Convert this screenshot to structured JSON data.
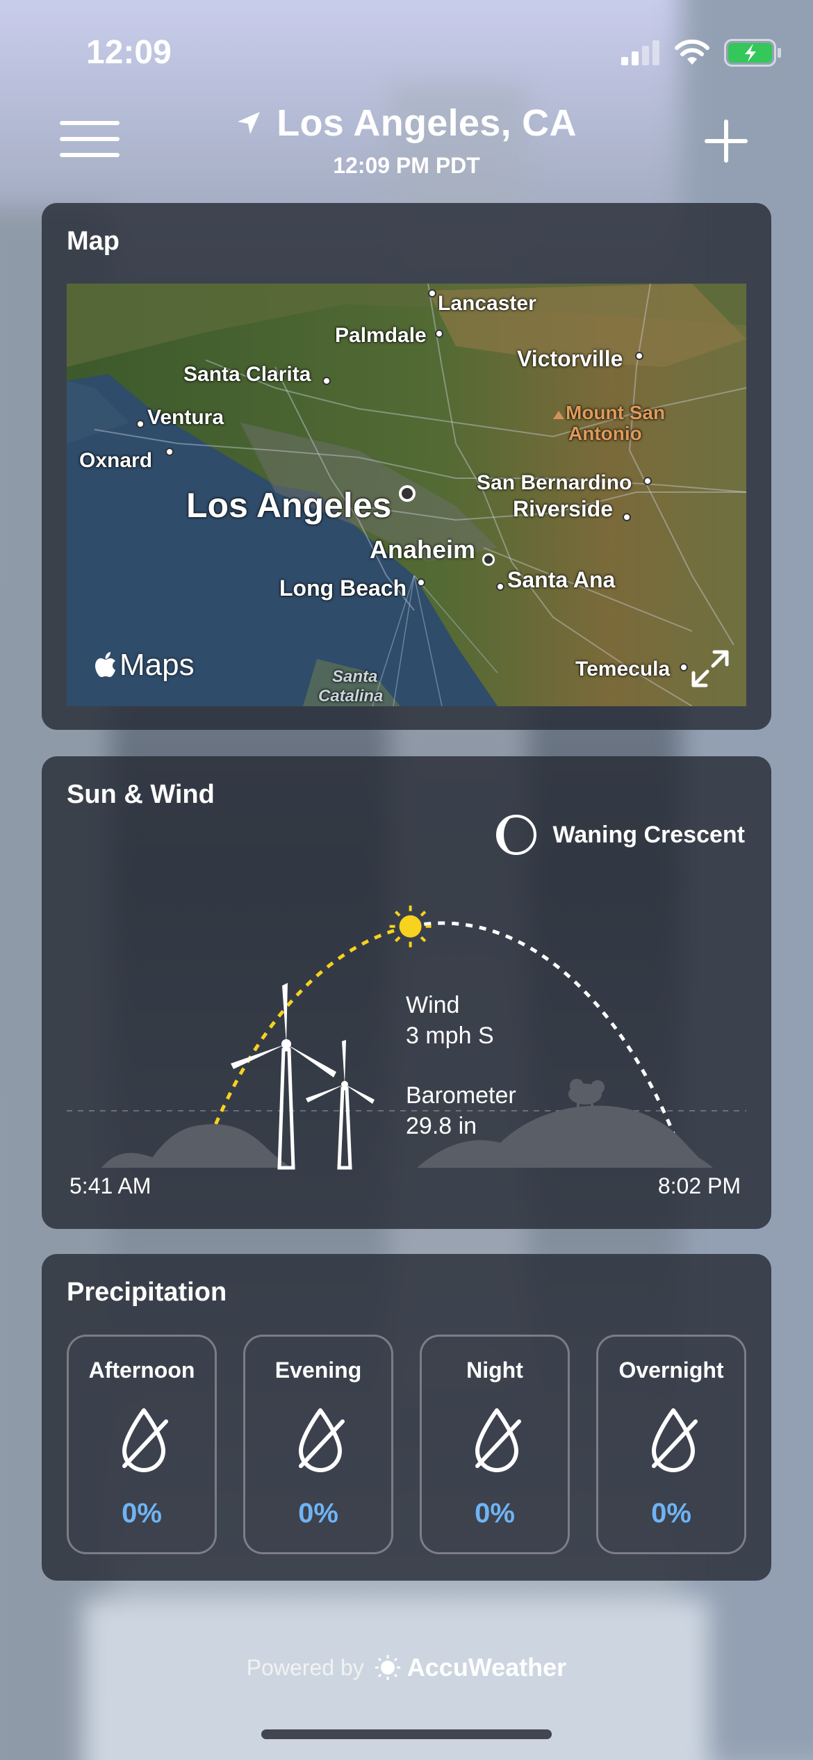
{
  "status_bar": {
    "time": "12:09",
    "icons": [
      "signal-icon",
      "wifi-icon",
      "battery-charging-icon"
    ]
  },
  "header": {
    "location": "Los Angeles, CA",
    "local_time": "12:09 PM PDT",
    "menu_icon": "hamburger-menu-icon",
    "location_icon": "location-arrow-icon",
    "add_icon": "plus-icon"
  },
  "map_card": {
    "title": "Map",
    "brand": "Maps",
    "places": {
      "lancaster": "Lancaster",
      "palmdale": "Palmdale",
      "victorville": "Victorville",
      "santa_clarita": "Santa Clarita",
      "mount_san_antonio_1": "Mount San",
      "mount_san_antonio_2": "Antonio",
      "ventura": "Ventura",
      "oxnard": "Oxnard",
      "san_bernardino": "San Bernardino",
      "los_angeles": "Los Angeles",
      "riverside": "Riverside",
      "anaheim": "Anaheim",
      "long_beach": "Long Beach",
      "santa_ana": "Santa Ana",
      "santa_catalina_1": "Santa",
      "santa_catalina_2": "Catalina",
      "temecula": "Temecula"
    }
  },
  "sun_wind_card": {
    "title": "Sun & Wind",
    "moon_phase": "Waning Crescent",
    "wind_label": "Wind",
    "wind_value": "3 mph S",
    "barometer_label": "Barometer",
    "barometer_value": "29.8 in",
    "sunrise": "5:41 AM",
    "sunset": "8:02 PM",
    "day_progress": 0.44,
    "colors": {
      "sun": "#f7d21f",
      "arc_remaining": "#ffffff"
    }
  },
  "precipitation_card": {
    "title": "Precipitation",
    "periods": [
      {
        "label": "Afternoon",
        "value": "0%"
      },
      {
        "label": "Evening",
        "value": "0%"
      },
      {
        "label": "Night",
        "value": "0%"
      },
      {
        "label": "Overnight",
        "value": "0%"
      }
    ],
    "colors": {
      "value": "#6fb4f5"
    }
  },
  "footer": {
    "powered_by": "Powered by",
    "brand": "AccuWeather"
  }
}
